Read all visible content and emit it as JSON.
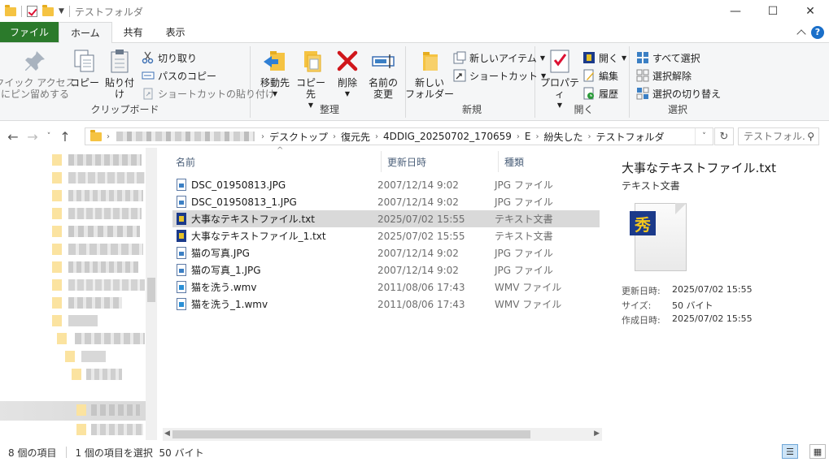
{
  "window": {
    "title": "テストフォルダ",
    "controls": {
      "minimize": "—",
      "maximize": "☐",
      "close": "✕"
    }
  },
  "ribbon_tabs": [
    {
      "label": "ファイル"
    },
    {
      "label": "ホーム"
    },
    {
      "label": "共有"
    },
    {
      "label": "表示"
    }
  ],
  "help_label": "?",
  "ribbon": {
    "clipboard": {
      "label": "クリップボード",
      "pin": "クイック アクセス\nにピン留めする",
      "copy": "コピー",
      "paste": "貼り付け",
      "cut": "切り取り",
      "copy_path": "パスのコピー",
      "paste_shortcut": "ショートカットの貼り付け"
    },
    "organize": {
      "label": "整理",
      "move_to": "移動先",
      "copy_to": "コピー先",
      "delete": "削除",
      "rename": "名前の\n変更"
    },
    "new": {
      "label": "新規",
      "new_folder": "新しい\nフォルダー",
      "new_item": "新しいアイテム",
      "shortcut": "ショートカット"
    },
    "open": {
      "label": "開く",
      "properties": "プロパティ",
      "open": "開く",
      "edit": "編集",
      "history": "履歴"
    },
    "select": {
      "label": "選択",
      "select_all": "すべて選択",
      "select_none": "選択解除",
      "invert": "選択の切り替え"
    }
  },
  "address": {
    "crumbs": [
      "デスクトップ",
      "復元先",
      "4DDIG_20250702_170659",
      "E",
      "紛失した",
      "テストフォルダ"
    ],
    "search_placeholder": "テストフォル..."
  },
  "columns": {
    "name": "名前",
    "date": "更新日時",
    "type": "種類"
  },
  "files": [
    {
      "name": "DSC_01950813.JPG",
      "date": "2007/12/14 9:02",
      "type": "JPG ファイル",
      "icon": "image-file-icon",
      "kind": "img"
    },
    {
      "name": "DSC_01950813_1.JPG",
      "date": "2007/12/14 9:02",
      "type": "JPG ファイル",
      "icon": "image-file-icon",
      "kind": "img"
    },
    {
      "name": "大事なテキストファイル.txt",
      "date": "2025/07/02 15:55",
      "type": "テキスト文書",
      "icon": "text-file-icon",
      "kind": "txt",
      "selected": true
    },
    {
      "name": "大事なテキストファイル_1.txt",
      "date": "2025/07/02 15:55",
      "type": "テキスト文書",
      "icon": "text-file-icon",
      "kind": "txt"
    },
    {
      "name": "猫の写真.JPG",
      "date": "2007/12/14 9:02",
      "type": "JPG ファイル",
      "icon": "image-file-icon",
      "kind": "img"
    },
    {
      "name": "猫の写真_1.JPG",
      "date": "2007/12/14 9:02",
      "type": "JPG ファイル",
      "icon": "image-file-icon",
      "kind": "img"
    },
    {
      "name": "猫を洗う.wmv",
      "date": "2011/08/06 17:43",
      "type": "WMV ファイル",
      "icon": "video-file-icon",
      "kind": "vid"
    },
    {
      "name": "猫を洗う_1.wmv",
      "date": "2011/08/06 17:43",
      "type": "WMV ファイル",
      "icon": "video-file-icon",
      "kind": "vid"
    }
  ],
  "details": {
    "title": "大事なテキストファイル.txt",
    "type": "テキスト文書",
    "badge_glyph": "秀",
    "modified_label": "更新日時:",
    "modified": "2025/07/02 15:55",
    "size_label": "サイズ:",
    "size": "50 バイト",
    "created_label": "作成日時:",
    "created": "2025/07/02 15:55"
  },
  "status": {
    "count": "8 個の項目",
    "selection": "1 個の項目を選択  50 バイト"
  }
}
